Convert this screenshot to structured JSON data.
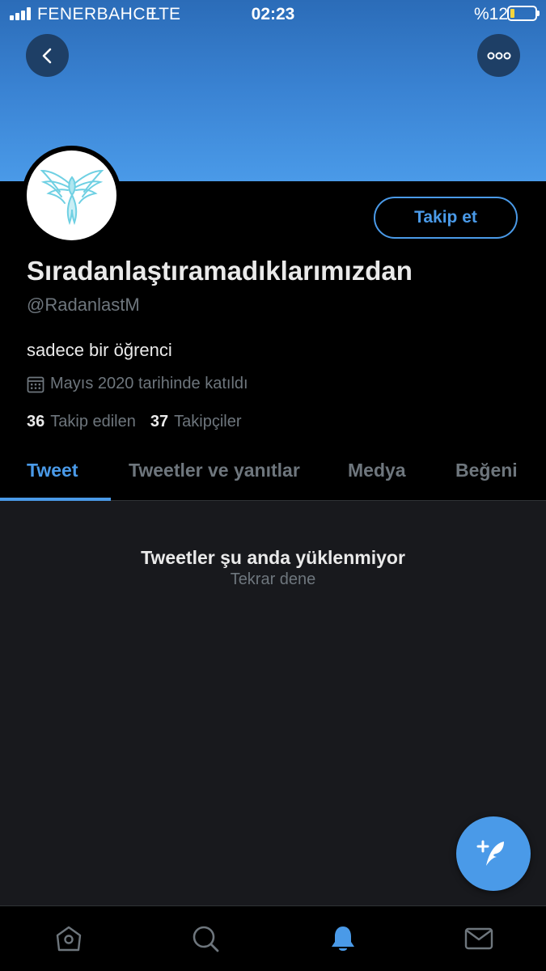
{
  "status_bar": {
    "carrier": "FENERBAHCE",
    "network": "LTE",
    "time": "02:23",
    "battery": "%12"
  },
  "header": {
    "back_icon": "chevron-left-icon",
    "more_icon": "more-horizontal-icon"
  },
  "profile": {
    "display_name": "Sıradanlaştıramadıklarımızdan",
    "handle": "@RadanlastM",
    "bio": "sadece bir öğrenci",
    "joined": "Mayıs 2020 tarihinde katıldı",
    "following_count": "36",
    "following_label": "Takip edilen",
    "followers_count": "37",
    "followers_label": "Takipçiler",
    "follow_button": "Takip et"
  },
  "tabs": [
    {
      "label": "Tweet",
      "active": true
    },
    {
      "label": "Tweetler ve yanıtlar",
      "active": false
    },
    {
      "label": "Medya",
      "active": false
    },
    {
      "label": "Beğeni",
      "active": false
    }
  ],
  "empty_state": {
    "title": "Tweetler şu anda yüklenmiyor",
    "retry": "Tekrar dene"
  },
  "bottom_nav": [
    "home-icon",
    "search-icon",
    "notifications-icon",
    "messages-icon"
  ],
  "colors": {
    "accent": "#4a9ae8",
    "background": "#000000",
    "content_bg": "#18191d",
    "muted_text": "#6e767d"
  }
}
